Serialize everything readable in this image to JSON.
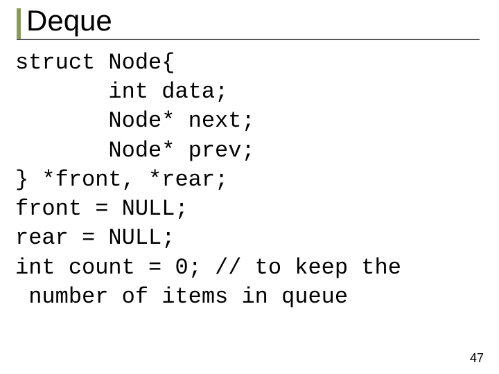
{
  "title": "Deque",
  "code_lines": [
    "struct Node{",
    "       int data;",
    "       Node* next;",
    "       Node* prev;",
    "} *front, *rear;",
    "front = NULL;",
    "rear = NULL;",
    "int count = 0; // to keep the",
    " number of items in queue"
  ],
  "page_number": "47"
}
